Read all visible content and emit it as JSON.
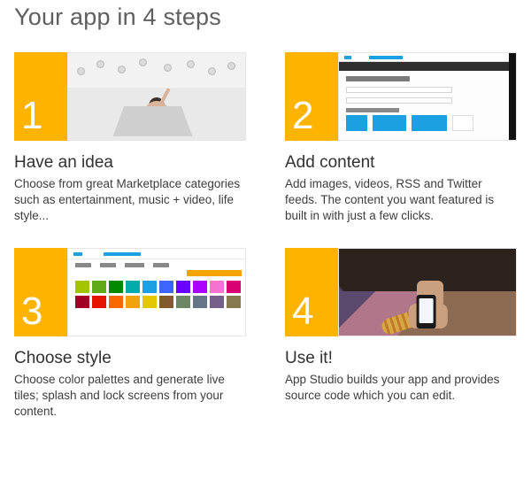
{
  "page": {
    "title": "Your app in 4 steps"
  },
  "steps": [
    {
      "number": "1",
      "title": "Have an idea",
      "description": "Choose from great Marketplace categories such as entertainment, music + video, life style..."
    },
    {
      "number": "2",
      "title": "Add content",
      "description": "Add images, videos, RSS and Twitter feeds. The content you want featured is built in with just a few clicks."
    },
    {
      "number": "3",
      "title": "Choose style",
      "description": "Choose color palettes and generate live tiles; splash and lock screens from your content."
    },
    {
      "number": "4",
      "title": "Use it!",
      "description": "App Studio builds your app and provides source code which you can edit."
    }
  ],
  "palette_colors": [
    "#a4c400",
    "#60a917",
    "#008a00",
    "#00aba9",
    "#1ba1e2",
    "#3e65ff",
    "#6a00ff",
    "#aa00ff",
    "#f472d0",
    "#d80073",
    "#a20025",
    "#e51400",
    "#fa6800",
    "#f0a30a",
    "#e3c800",
    "#825a2c",
    "#6d8764",
    "#647687",
    "#76608a",
    "#87794e"
  ]
}
